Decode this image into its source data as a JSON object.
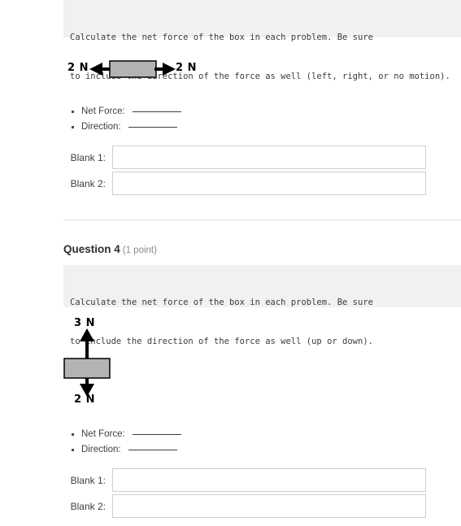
{
  "question3": {
    "prompt_line1": "Calculate the net force of the box in each problem. Be sure",
    "prompt_line2": "to include the direction of the force as well (left, right, or no motion).",
    "diagram": {
      "type": "horizontal-force-diagram",
      "left_force_label": "2 N",
      "right_force_label": "2 N",
      "left_arrow_icon": "arrow-left-icon",
      "right_arrow_icon": "arrow-right-icon",
      "box_icon": "gray-box-icon",
      "box_color": "#b3b3b3"
    },
    "bullets": [
      {
        "label": "Net Force:"
      },
      {
        "label": "Direction:"
      }
    ],
    "blanks": [
      {
        "label": "Blank 1:",
        "value": "",
        "placeholder": ""
      },
      {
        "label": "Blank 2:",
        "value": "",
        "placeholder": ""
      }
    ]
  },
  "question4": {
    "title": "Question 4",
    "points": "(1 point)",
    "prompt_line1": "Calculate the net force of the box in each problem. Be sure",
    "prompt_line2": "to include the direction of the force as well (up or down).",
    "diagram": {
      "type": "vertical-force-diagram",
      "top_force_label": "3 N",
      "bottom_force_label": "2 N",
      "up_arrow_icon": "arrow-up-icon",
      "down_arrow_icon": "arrow-down-icon",
      "box_icon": "gray-box-icon",
      "box_color": "#b3b3b3"
    },
    "bullets": [
      {
        "label": "Net Force:"
      },
      {
        "label": "Direction:"
      }
    ],
    "blanks": [
      {
        "label": "Blank 1:",
        "value": "",
        "placeholder": ""
      },
      {
        "label": "Blank 2:",
        "value": "",
        "placeholder": ""
      }
    ]
  },
  "colors": {
    "prompt_background": "#f1f1f1",
    "box_fill": "#b3b3b3",
    "box_stroke": "#000000",
    "input_border": "#cfcfcf",
    "divider": "#e0e0e0",
    "text": "#3f3f3f"
  }
}
